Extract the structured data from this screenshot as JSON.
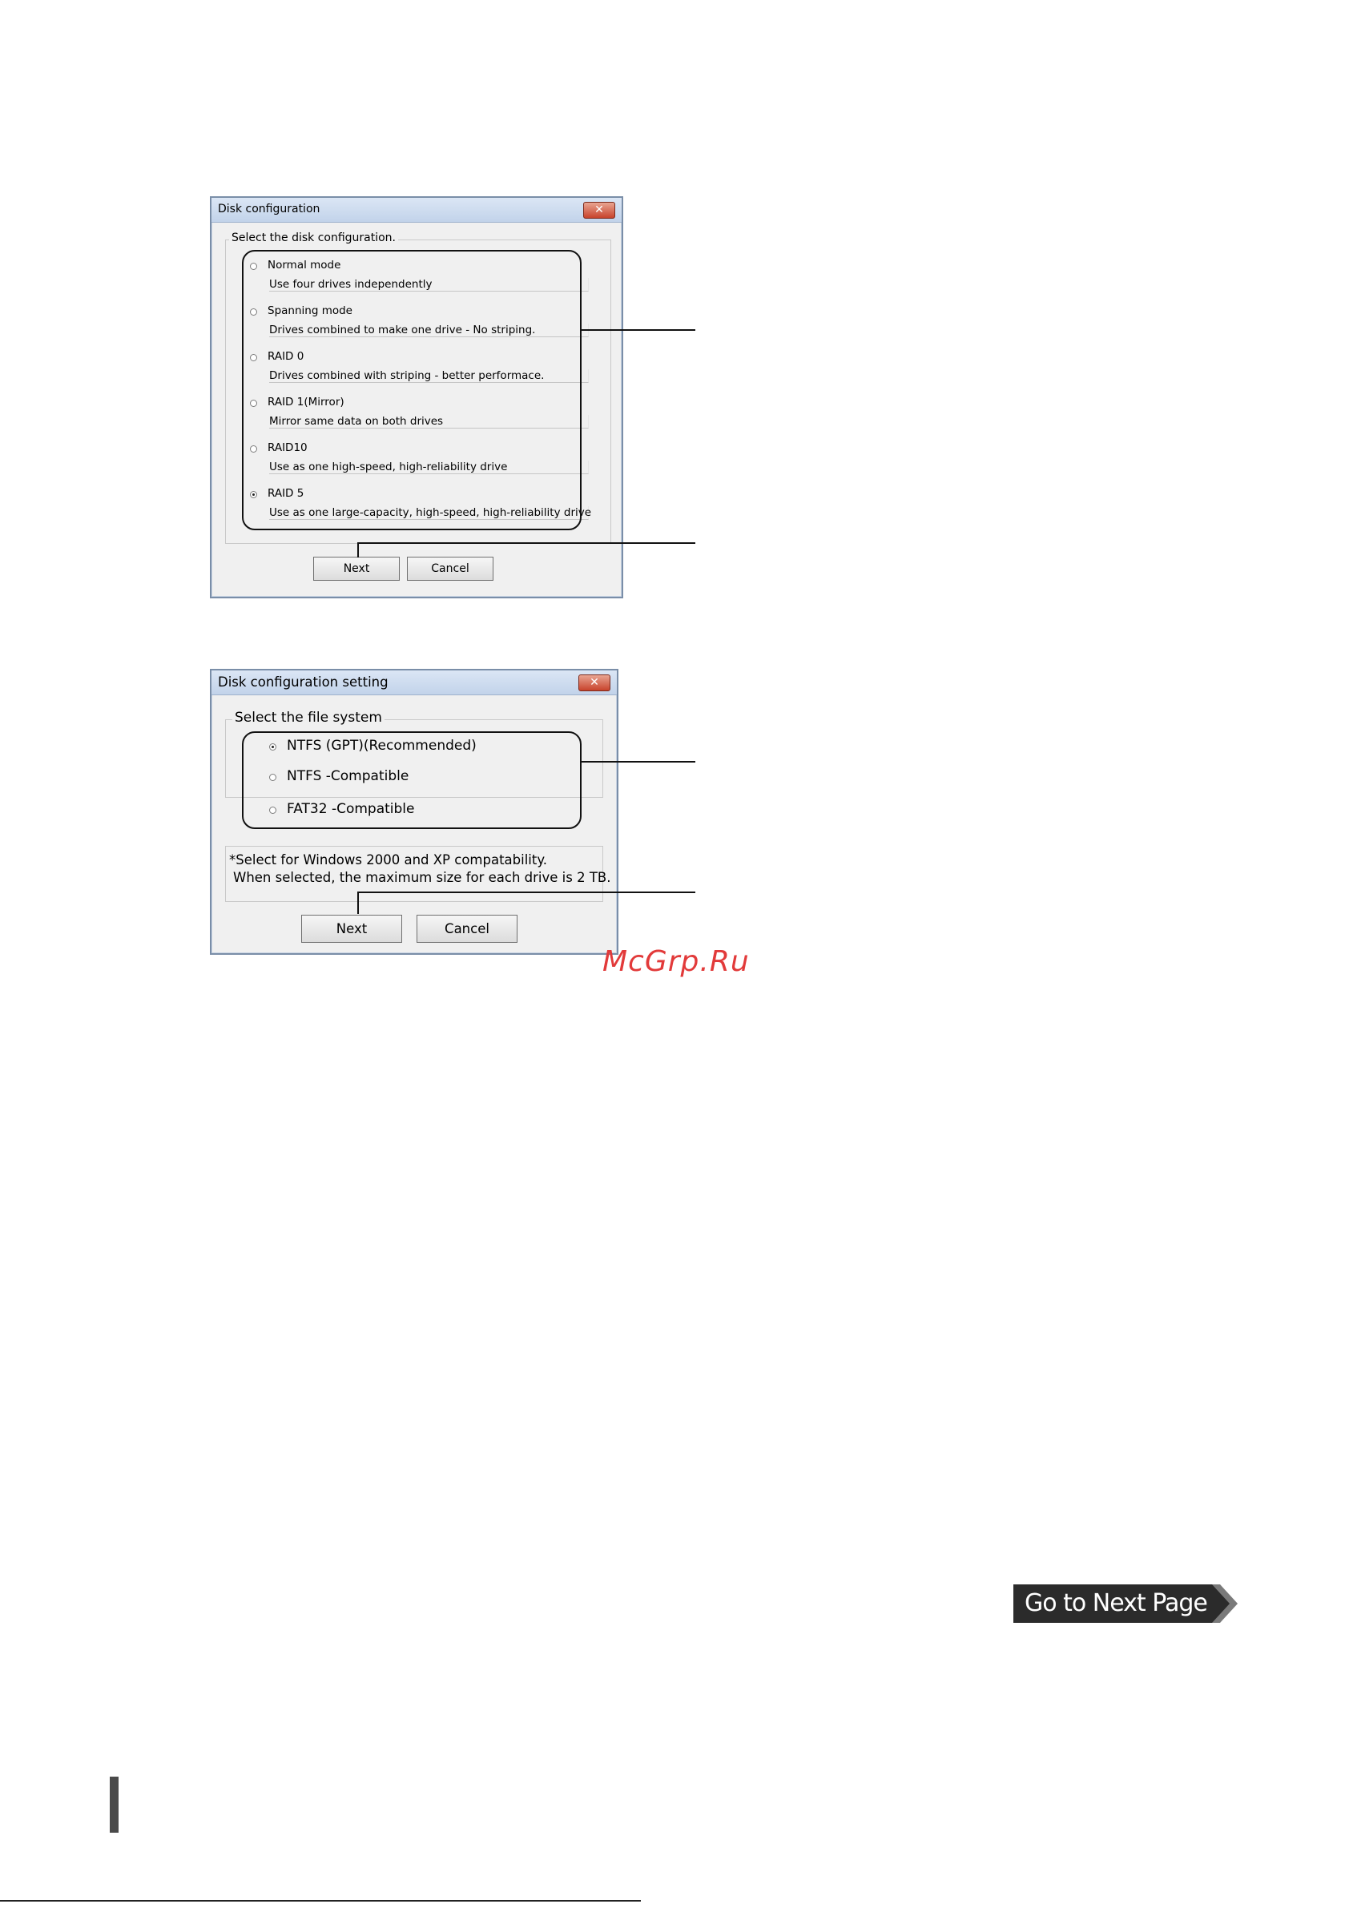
{
  "dialog1": {
    "title": "Disk configuration",
    "close_glyph": "✕",
    "group_label": "Select the disk configuration.",
    "options": [
      {
        "label": "Normal mode",
        "desc": "Use four drives independently",
        "selected": false
      },
      {
        "label": "Spanning mode",
        "desc": "Drives combined to make one drive - No striping.",
        "selected": false
      },
      {
        "label": "RAID 0",
        "desc": "Drives combined with striping - better performace.",
        "selected": false
      },
      {
        "label": "RAID 1(Mirror)",
        "desc": "Mirror same data on both drives",
        "selected": false
      },
      {
        "label": "RAID10",
        "desc": "Use as one high-speed, high-reliability drive",
        "selected": false
      },
      {
        "label": "RAID 5",
        "desc": "Use as one large-capacity, high-speed, high-reliability drive",
        "selected": true
      }
    ],
    "next_label": "Next",
    "cancel_label": "Cancel"
  },
  "dialog2": {
    "title": "Disk configuration setting",
    "close_glyph": "✕",
    "group_label": "Select the file system",
    "options": [
      {
        "label": "NTFS (GPT)(Recommended)",
        "selected": true
      },
      {
        "label": "NTFS -Compatible",
        "selected": false
      },
      {
        "label": "FAT32 -Compatible",
        "selected": false
      }
    ],
    "note_line1": "*Select for Windows 2000 and XP compatability.",
    "note_line2": "When selected, the maximum size for each drive is 2 TB.",
    "next_label": "Next",
    "cancel_label": "Cancel"
  },
  "watermark": "McGrp.Ru",
  "next_page_label": "Go to Next Page",
  "colors": {
    "dialog_bg": "#f0f0f0",
    "titlebar": "#c2d3ea",
    "close_button": "#c8432c",
    "watermark": "#e23a3a",
    "next_page_bg": "#2b2b2b"
  }
}
